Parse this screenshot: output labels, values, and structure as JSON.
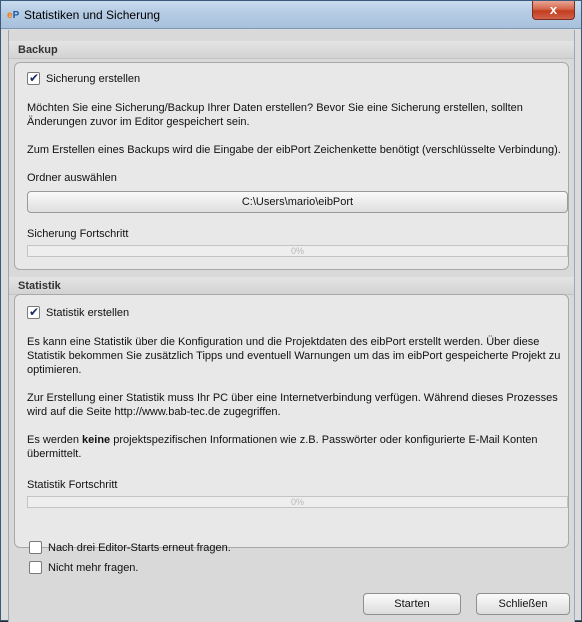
{
  "window": {
    "title": "Statistiken und Sicherung",
    "close_label": "x"
  },
  "backup": {
    "section_title": "Backup",
    "checkbox_label": "Sicherung erstellen",
    "checkbox_checked": true,
    "description_1": "Möchten Sie eine Sicherung/Backup Ihrer Daten erstellen? Bevor Sie eine Sicherung erstellen, sollten Änderungen zuvor im Editor gespeichert sein.",
    "description_2": "Zum Erstellen eines Backups wird die Eingabe der eibPort Zeichenkette benötigt (verschlüsselte Verbindung).",
    "folder_label": "Ordner auswählen",
    "folder_path": "C:\\Users\\mario\\eibPort",
    "progress_label": "Sicherung Fortschritt",
    "progress_text": "0%",
    "progress_value": 0
  },
  "statistik": {
    "section_title": "Statistik",
    "checkbox_label": "Statistik erstellen",
    "checkbox_checked": true,
    "description_1": "Es kann eine Statistik über die Konfiguration und die Projektdaten des eibPort erstellt werden. Über diese Statistik bekommen Sie zusätzlich Tipps und eventuell Warnungen um das im eibPort gespeicherte Projekt zu optimieren.",
    "description_2": "Zur Erstellung einer Statistik muss Ihr PC über eine Internetverbindung verfügen. Während dieses Prozesses wird auf die Seite http://www.bab-tec.de zugegriffen.",
    "description_3_pre": "Es werden ",
    "description_3_bold": "keine",
    "description_3_post": " projektspezifischen Informationen wie z.B. Passwörter oder konfigurierte E-Mail Konten übermittelt.",
    "progress_label": "Statistik Fortschritt",
    "progress_text": "0%",
    "progress_value": 0
  },
  "options": {
    "ask_again_label": "Nach drei Editor-Starts erneut fragen.",
    "ask_again_checked": false,
    "never_ask_label": "Nicht mehr fragen.",
    "never_ask_checked": false
  },
  "footer": {
    "start_label": "Starten",
    "close_label": "Schließen"
  }
}
